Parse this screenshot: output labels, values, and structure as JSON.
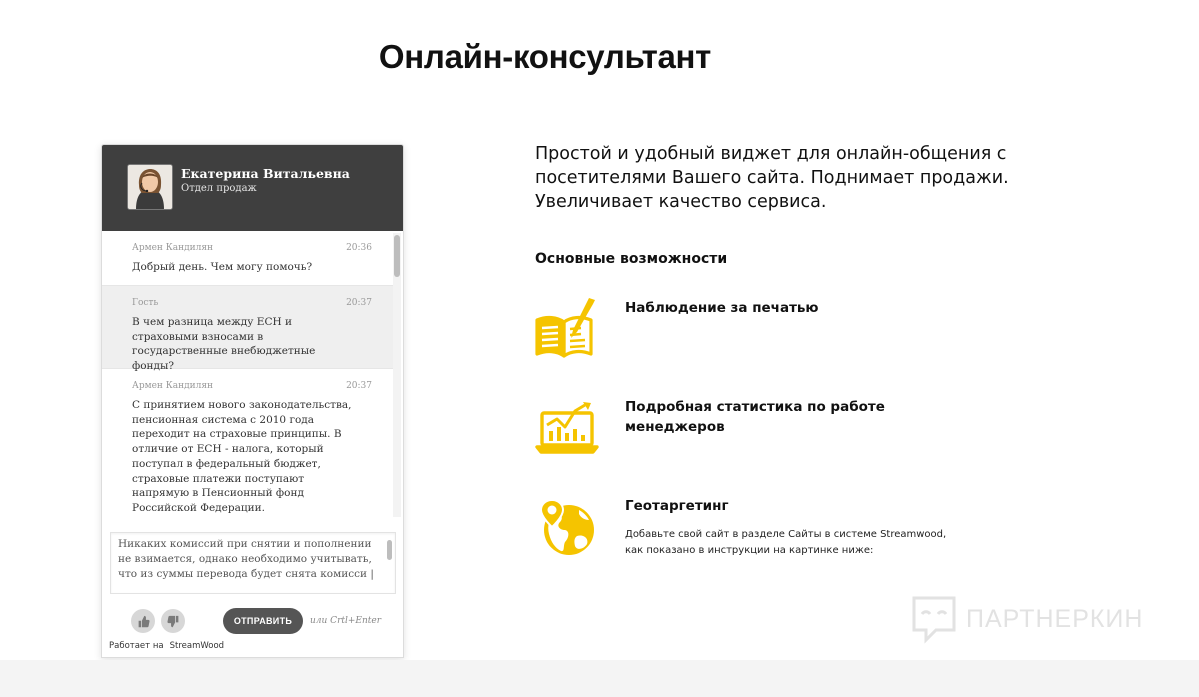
{
  "page": {
    "title": "Онлайн-консультант"
  },
  "widget": {
    "agent_name": "Екатерина Витальевна",
    "agent_dept": "Отдел продаж",
    "messages": [
      {
        "author": "Армен Кандилян",
        "time": "20:36",
        "text": "Добрый день. Чем могу помочь?"
      },
      {
        "author": "Гость",
        "time": "20:37",
        "text": "В чем разница между ЕСН и страховыми взносами в государственные внебюджетные фонды?"
      },
      {
        "author": "Армен Кандилян",
        "time": "20:37",
        "text": "С принятием нового законодательства, пенсионная система с 2010 года переходит на страховые принципы. В отличие от ЕСН - налога, который поступал в федеральный бюджет, страховые платежи поступают напрямую в Пенсионный фонд Российской Федерации."
      }
    ],
    "composer_text": "Никаких комиссий при снятии и пополнении не взимается, однако необходимо учитывать, что из суммы перевода будет снята комисси |",
    "send_label": "ОТПРАВИТЬ",
    "shortcut_hint": "или Crtl+Enter",
    "powered_label": "Работает на",
    "powered_brand": "StreamWood",
    "icons": {
      "like": "thumbs-up-icon",
      "dislike": "thumbs-down-icon"
    }
  },
  "content": {
    "intro": "Простой и удобный виджет для онлайн-общения с посетителями Вашего сайта. Поднимает продажи. Увеличивает качество сервиса.",
    "features_heading": "Основные возможности",
    "features": [
      {
        "title": "Наблюдение за печатью",
        "icon": "book-pen-icon"
      },
      {
        "title": "Подробная статистика по работе менеджеров",
        "icon": "chart-laptop-icon"
      },
      {
        "title": "Геотаргетинг",
        "icon": "globe-pin-icon",
        "desc": "Добавьте свой сайт в разделе Сайты в системе Streamwood, как показано в инструкции на картинке ниже:"
      }
    ],
    "accent_color": "#f5c400"
  },
  "watermark": {
    "text": "ПАРТНЕРКИН"
  }
}
